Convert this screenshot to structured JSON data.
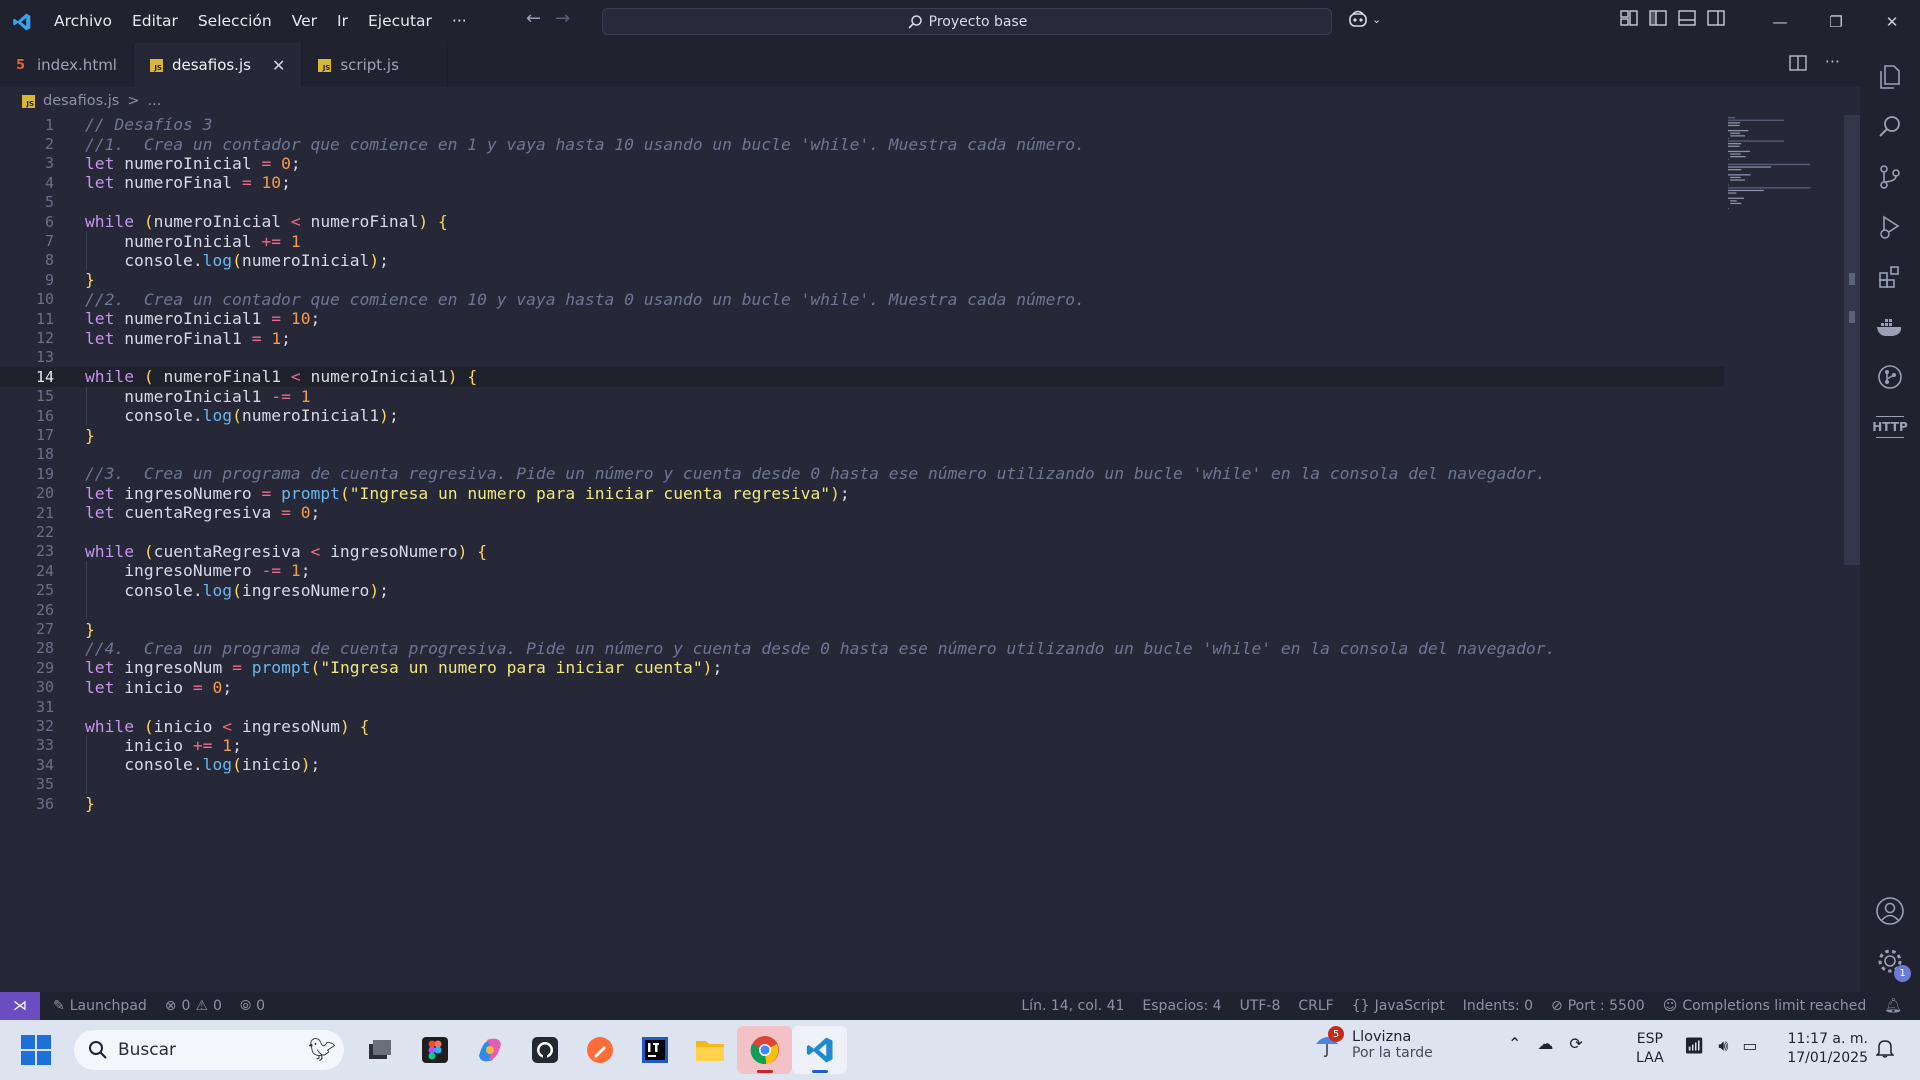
{
  "titlebar": {
    "menu": [
      "Archivo",
      "Editar",
      "Selección",
      "Ver",
      "Ir",
      "Ejecutar",
      "···"
    ],
    "search_text": "Proyecto base"
  },
  "tabs": [
    {
      "label": "index.html",
      "icon": "html-file-icon",
      "active": false
    },
    {
      "label": "desafios.js",
      "icon": "js-file-icon",
      "active": true
    },
    {
      "label": "script.js",
      "icon": "js-file-icon",
      "active": false
    }
  ],
  "breadcrumb": {
    "file": "desafios.js",
    "separator": ">",
    "rest": "..."
  },
  "editor": {
    "current_line": 14,
    "lines": [
      "// Desafíos 3",
      "//1.  Crea un contador que comience en 1 y vaya hasta 10 usando un bucle 'while'. Muestra cada número.",
      "let numeroInicial = 0;",
      "let numeroFinal = 10;",
      "",
      "while (numeroInicial < numeroFinal) {",
      "    numeroInicial += 1",
      "    console.log(numeroInicial);",
      "}",
      "//2.  Crea un contador que comience en 10 y vaya hasta 0 usando un bucle 'while'. Muestra cada número.",
      "let numeroInicial1 = 10;",
      "let numeroFinal1 = 1;",
      "",
      "while ( numeroFinal1 < numeroInicial1) {",
      "    numeroInicial1 -= 1",
      "    console.log(numeroInicial1);",
      "}",
      "",
      "//3.  Crea un programa de cuenta regresiva. Pide un número y cuenta desde 0 hasta ese número utilizando un bucle 'while' en la consola del navegador.",
      "let ingresoNumero = prompt(\"Ingresa un numero para iniciar cuenta regresiva\");",
      "let cuentaRegresiva = 0;",
      "",
      "while (cuentaRegresiva < ingresoNumero) {",
      "    ingresoNumero -= 1;",
      "    console.log(ingresoNumero);",
      "",
      "}",
      "//4.  Crea un programa de cuenta progresiva. Pide un número y cuenta desde 0 hasta ese número utilizando un bucle 'while' en la consola del navegador.",
      "let ingresoNum = prompt(\"Ingresa un numero para iniciar cuenta\");",
      "let inicio = 0;",
      "",
      "while (inicio < ingresoNum) {",
      "    inicio += 1;",
      "    console.log(inicio);",
      "",
      "}"
    ]
  },
  "activitybar": {
    "items": [
      "explorer-icon",
      "search-icon",
      "source-control-icon",
      "run-debug-icon",
      "extensions-icon",
      "docker-icon",
      "git-graph-icon",
      "http-icon",
      "accounts-icon",
      "manage-gear-icon"
    ],
    "http_label": "HTTP",
    "settings_badge": "1"
  },
  "statusbar": {
    "launchpad": "Launchpad",
    "errors": "0",
    "warnings": "0",
    "ports": "0",
    "position": "Lín. 14, col. 41",
    "spaces": "Espacios: 4",
    "encoding": "UTF-8",
    "eol": "CRLF",
    "language": "JavaScript",
    "indents": "Indents: 0",
    "port": "Port : 5500",
    "completions": "Completions limit reached"
  },
  "taskbar": {
    "search_placeholder": "Buscar",
    "apps": [
      "task-view-icon",
      "figma-icon",
      "copilot-icon",
      "github-desktop-icon",
      "postman-icon",
      "intellij-icon",
      "file-explorer-icon",
      "chrome-icon",
      "vscode-icon"
    ],
    "weather_badge": "5",
    "weather_title": "Llovizna",
    "weather_sub": "Por la tarde",
    "lang_top": "ESP",
    "lang_bottom": "LAA",
    "time": "11:17 a. m.",
    "date": "17/01/2025"
  },
  "colors": {
    "editor_bg": "#262838",
    "chrome_bg": "#20222f",
    "remote_purple": "#6a4ec0",
    "keyword": "#c794ec",
    "number": "#f79a4c",
    "string": "#f1e77b",
    "function": "#69b7ee",
    "comment": "#6f7694"
  }
}
